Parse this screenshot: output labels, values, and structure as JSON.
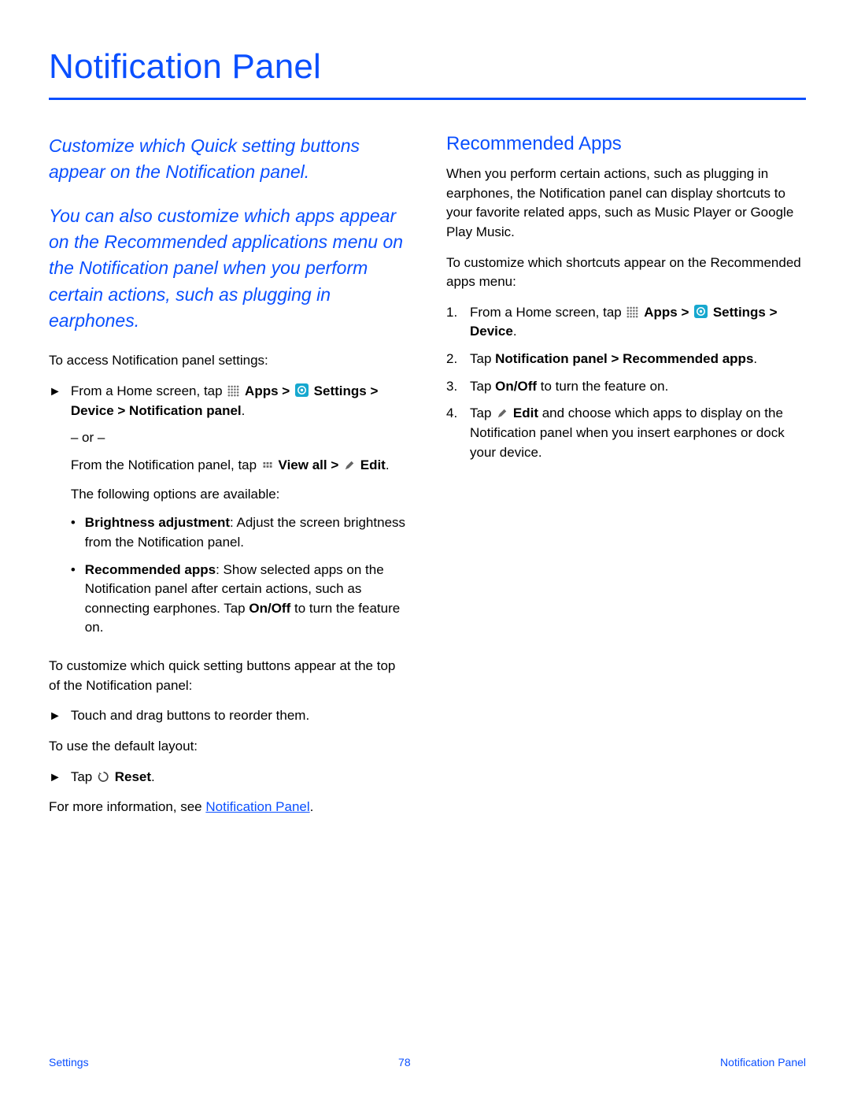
{
  "title": "Notification Panel",
  "intro1": "Customize which Quick setting buttons appear on the Notification panel.",
  "intro2": "You can also customize which apps appear on the Recommended applications menu on the Notification panel when you perform certain actions, such as plugging in earphones.",
  "access_lead": "To access Notification panel settings:",
  "access_step_prefix": "From a Home screen, tap ",
  "label_apps": "Apps",
  "label_apps_gt": " > ",
  "label_settings": "Settings",
  "access_step_suffix": " > Device > Notification panel",
  "or": "– or –",
  "alt_prefix": "From the Notification panel, tap ",
  "label_viewall": "View all",
  "alt_gt": " > ",
  "label_edit": "Edit",
  "options_lead": "The following options are available:",
  "opt1_label": "Brightness adjustment",
  "opt1_text": ": Adjust the screen brightness from the Notification panel.",
  "opt2_label": "Recommended apps",
  "opt2_text_a": ": Show selected apps on the Notification panel after certain actions, such as connecting earphones. Tap ",
  "onoff": "On/Off",
  "opt2_text_b": " to turn the feature on.",
  "customize_lead": "To customize which quick setting buttons appear at the top of the Notification panel:",
  "customize_step": "Touch and drag buttons to reorder them.",
  "default_lead": "To use the default layout:",
  "reset_prefix": "Tap ",
  "label_reset": "Reset",
  "moreinfo_prefix": "For more information, see ",
  "moreinfo_link": "Notification Panel",
  "moreinfo_suffix": ".",
  "section_heading": "Recommended Apps",
  "ra_para1": "When you perform certain actions, such as plugging in earphones, the Notification panel can display shortcuts to your favorite related apps, such as Music Player or Google Play Music.",
  "ra_para2": "To customize which shortcuts appear on the Recommended apps menu:",
  "ra1_prefix": "From a Home screen, tap ",
  "ra1_suffix": " > Device",
  "ra2_prefix": "Tap ",
  "ra2_bold": "Notification panel > Recommended apps",
  "ra3_prefix": "Tap ",
  "ra3_suffix": " to turn the feature on.",
  "ra4_prefix": "Tap ",
  "ra4_bold_edit": "Edit",
  "ra4_text": " and choose which apps to display on the Notification panel when you insert earphones or dock your device.",
  "n1": "1.",
  "n2": "2.",
  "n3": "3.",
  "n4": "4.",
  "period": ".",
  "footer_left": "Settings",
  "footer_center": "78",
  "footer_right": "Notification Panel"
}
